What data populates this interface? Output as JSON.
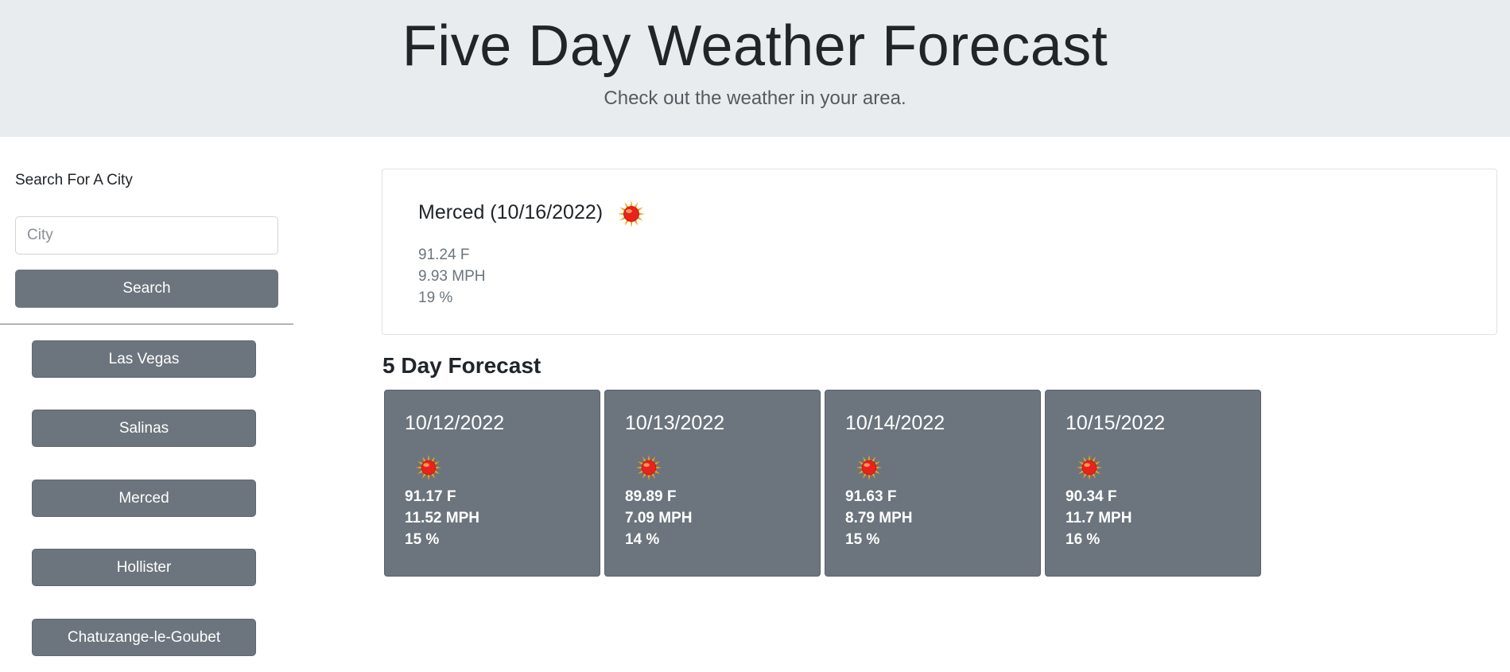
{
  "header": {
    "title": "Five Day Weather Forecast",
    "subtitle": "Check out the weather in your area."
  },
  "sidebar": {
    "search_label": "Search For A City",
    "city_placeholder": "City",
    "search_button": "Search",
    "history": [
      "Las Vegas",
      "Salinas",
      "Merced",
      "Hollister",
      "Chatuzange-le-Goubet"
    ]
  },
  "current": {
    "title": "Merced (10/16/2022)",
    "icon": "sun-icon",
    "temp": "91.24 F",
    "wind": "9.93 MPH",
    "humidity": "19 %"
  },
  "forecast": {
    "heading": "5 Day Forecast",
    "days": [
      {
        "date": "10/12/2022",
        "icon": "sun-icon",
        "temp": "91.17 F",
        "wind": "11.52 MPH",
        "humidity": "15 %"
      },
      {
        "date": "10/13/2022",
        "icon": "sun-icon",
        "temp": "89.89 F",
        "wind": "7.09 MPH",
        "humidity": "14 %"
      },
      {
        "date": "10/14/2022",
        "icon": "sun-icon",
        "temp": "91.63 F",
        "wind": "8.79 MPH",
        "humidity": "15 %"
      },
      {
        "date": "10/15/2022",
        "icon": "sun-icon",
        "temp": "90.34 F",
        "wind": "11.7 MPH",
        "humidity": "16 %"
      }
    ]
  },
  "colors": {
    "header_bg": "#e9ecef",
    "button_bg": "#6c757d",
    "sun_core": "#e8231b",
    "sun_rays": "#f5a31a"
  }
}
